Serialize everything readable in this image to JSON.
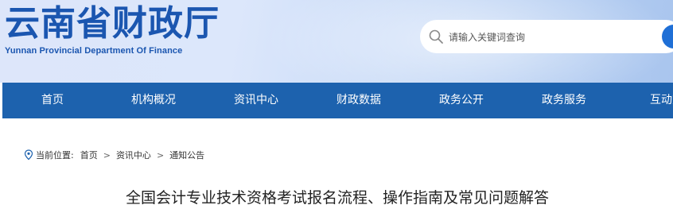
{
  "header": {
    "logo_cn": "云南省财政厅",
    "logo_en": "Yunnan Provincial Department Of Finance"
  },
  "search": {
    "placeholder": "请输入关键词查询",
    "icon": "search-icon"
  },
  "nav": {
    "items": [
      {
        "label": "首页"
      },
      {
        "label": "机构概况"
      },
      {
        "label": "资讯中心"
      },
      {
        "label": "财政数据"
      },
      {
        "label": "政务公开"
      },
      {
        "label": "政务服务"
      },
      {
        "label": "互动交"
      }
    ]
  },
  "breadcrumb": {
    "prefix": "当前位置:",
    "items": [
      "首页",
      "资讯中心",
      "通知公告"
    ],
    "separator": ">"
  },
  "article": {
    "title": "全国会计专业技术资格考试报名流程、操作指南及常见问题解答"
  },
  "colors": {
    "brand_blue": "#1b56b0",
    "nav_bg": "#1d62ae",
    "search_button": "#1f6fd6"
  }
}
